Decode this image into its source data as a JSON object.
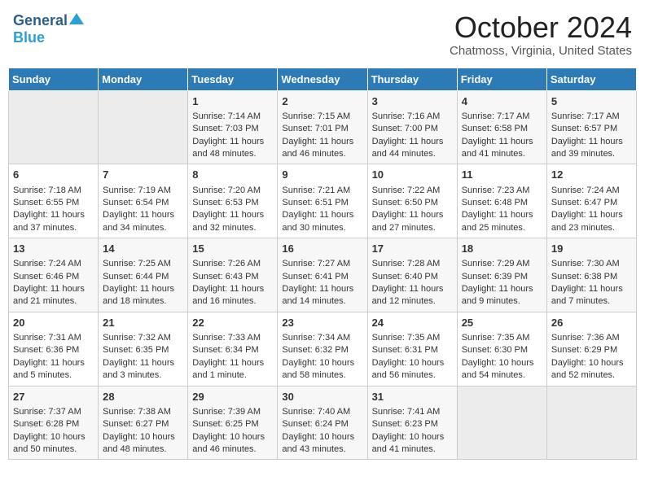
{
  "header": {
    "logo_general": "General",
    "logo_blue": "Blue",
    "month": "October 2024",
    "location": "Chatmoss, Virginia, United States"
  },
  "weekdays": [
    "Sunday",
    "Monday",
    "Tuesday",
    "Wednesday",
    "Thursday",
    "Friday",
    "Saturday"
  ],
  "weeks": [
    [
      {
        "day": "",
        "sunrise": "",
        "sunset": "",
        "daylight": ""
      },
      {
        "day": "",
        "sunrise": "",
        "sunset": "",
        "daylight": ""
      },
      {
        "day": "1",
        "sunrise": "Sunrise: 7:14 AM",
        "sunset": "Sunset: 7:03 PM",
        "daylight": "Daylight: 11 hours and 48 minutes."
      },
      {
        "day": "2",
        "sunrise": "Sunrise: 7:15 AM",
        "sunset": "Sunset: 7:01 PM",
        "daylight": "Daylight: 11 hours and 46 minutes."
      },
      {
        "day": "3",
        "sunrise": "Sunrise: 7:16 AM",
        "sunset": "Sunset: 7:00 PM",
        "daylight": "Daylight: 11 hours and 44 minutes."
      },
      {
        "day": "4",
        "sunrise": "Sunrise: 7:17 AM",
        "sunset": "Sunset: 6:58 PM",
        "daylight": "Daylight: 11 hours and 41 minutes."
      },
      {
        "day": "5",
        "sunrise": "Sunrise: 7:17 AM",
        "sunset": "Sunset: 6:57 PM",
        "daylight": "Daylight: 11 hours and 39 minutes."
      }
    ],
    [
      {
        "day": "6",
        "sunrise": "Sunrise: 7:18 AM",
        "sunset": "Sunset: 6:55 PM",
        "daylight": "Daylight: 11 hours and 37 minutes."
      },
      {
        "day": "7",
        "sunrise": "Sunrise: 7:19 AM",
        "sunset": "Sunset: 6:54 PM",
        "daylight": "Daylight: 11 hours and 34 minutes."
      },
      {
        "day": "8",
        "sunrise": "Sunrise: 7:20 AM",
        "sunset": "Sunset: 6:53 PM",
        "daylight": "Daylight: 11 hours and 32 minutes."
      },
      {
        "day": "9",
        "sunrise": "Sunrise: 7:21 AM",
        "sunset": "Sunset: 6:51 PM",
        "daylight": "Daylight: 11 hours and 30 minutes."
      },
      {
        "day": "10",
        "sunrise": "Sunrise: 7:22 AM",
        "sunset": "Sunset: 6:50 PM",
        "daylight": "Daylight: 11 hours and 27 minutes."
      },
      {
        "day": "11",
        "sunrise": "Sunrise: 7:23 AM",
        "sunset": "Sunset: 6:48 PM",
        "daylight": "Daylight: 11 hours and 25 minutes."
      },
      {
        "day": "12",
        "sunrise": "Sunrise: 7:24 AM",
        "sunset": "Sunset: 6:47 PM",
        "daylight": "Daylight: 11 hours and 23 minutes."
      }
    ],
    [
      {
        "day": "13",
        "sunrise": "Sunrise: 7:24 AM",
        "sunset": "Sunset: 6:46 PM",
        "daylight": "Daylight: 11 hours and 21 minutes."
      },
      {
        "day": "14",
        "sunrise": "Sunrise: 7:25 AM",
        "sunset": "Sunset: 6:44 PM",
        "daylight": "Daylight: 11 hours and 18 minutes."
      },
      {
        "day": "15",
        "sunrise": "Sunrise: 7:26 AM",
        "sunset": "Sunset: 6:43 PM",
        "daylight": "Daylight: 11 hours and 16 minutes."
      },
      {
        "day": "16",
        "sunrise": "Sunrise: 7:27 AM",
        "sunset": "Sunset: 6:41 PM",
        "daylight": "Daylight: 11 hours and 14 minutes."
      },
      {
        "day": "17",
        "sunrise": "Sunrise: 7:28 AM",
        "sunset": "Sunset: 6:40 PM",
        "daylight": "Daylight: 11 hours and 12 minutes."
      },
      {
        "day": "18",
        "sunrise": "Sunrise: 7:29 AM",
        "sunset": "Sunset: 6:39 PM",
        "daylight": "Daylight: 11 hours and 9 minutes."
      },
      {
        "day": "19",
        "sunrise": "Sunrise: 7:30 AM",
        "sunset": "Sunset: 6:38 PM",
        "daylight": "Daylight: 11 hours and 7 minutes."
      }
    ],
    [
      {
        "day": "20",
        "sunrise": "Sunrise: 7:31 AM",
        "sunset": "Sunset: 6:36 PM",
        "daylight": "Daylight: 11 hours and 5 minutes."
      },
      {
        "day": "21",
        "sunrise": "Sunrise: 7:32 AM",
        "sunset": "Sunset: 6:35 PM",
        "daylight": "Daylight: 11 hours and 3 minutes."
      },
      {
        "day": "22",
        "sunrise": "Sunrise: 7:33 AM",
        "sunset": "Sunset: 6:34 PM",
        "daylight": "Daylight: 11 hours and 1 minute."
      },
      {
        "day": "23",
        "sunrise": "Sunrise: 7:34 AM",
        "sunset": "Sunset: 6:32 PM",
        "daylight": "Daylight: 10 hours and 58 minutes."
      },
      {
        "day": "24",
        "sunrise": "Sunrise: 7:35 AM",
        "sunset": "Sunset: 6:31 PM",
        "daylight": "Daylight: 10 hours and 56 minutes."
      },
      {
        "day": "25",
        "sunrise": "Sunrise: 7:35 AM",
        "sunset": "Sunset: 6:30 PM",
        "daylight": "Daylight: 10 hours and 54 minutes."
      },
      {
        "day": "26",
        "sunrise": "Sunrise: 7:36 AM",
        "sunset": "Sunset: 6:29 PM",
        "daylight": "Daylight: 10 hours and 52 minutes."
      }
    ],
    [
      {
        "day": "27",
        "sunrise": "Sunrise: 7:37 AM",
        "sunset": "Sunset: 6:28 PM",
        "daylight": "Daylight: 10 hours and 50 minutes."
      },
      {
        "day": "28",
        "sunrise": "Sunrise: 7:38 AM",
        "sunset": "Sunset: 6:27 PM",
        "daylight": "Daylight: 10 hours and 48 minutes."
      },
      {
        "day": "29",
        "sunrise": "Sunrise: 7:39 AM",
        "sunset": "Sunset: 6:25 PM",
        "daylight": "Daylight: 10 hours and 46 minutes."
      },
      {
        "day": "30",
        "sunrise": "Sunrise: 7:40 AM",
        "sunset": "Sunset: 6:24 PM",
        "daylight": "Daylight: 10 hours and 43 minutes."
      },
      {
        "day": "31",
        "sunrise": "Sunrise: 7:41 AM",
        "sunset": "Sunset: 6:23 PM",
        "daylight": "Daylight: 10 hours and 41 minutes."
      },
      {
        "day": "",
        "sunrise": "",
        "sunset": "",
        "daylight": ""
      },
      {
        "day": "",
        "sunrise": "",
        "sunset": "",
        "daylight": ""
      }
    ]
  ]
}
